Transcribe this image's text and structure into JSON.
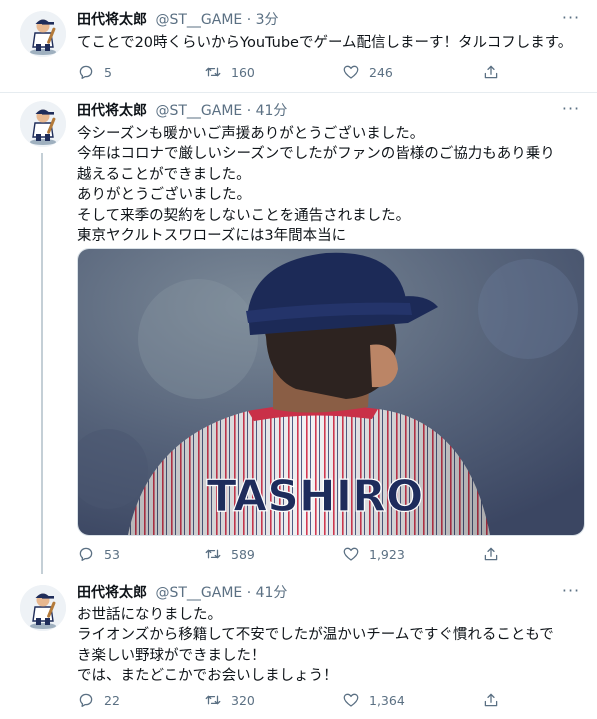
{
  "colors": {
    "text": "#0f1419",
    "muted": "#5b7083",
    "divider": "#e6ecf0",
    "thread": "#c4cfd6"
  },
  "tweets": [
    {
      "name": "田代将太郎",
      "handle": "@ST__GAME",
      "dot": "·",
      "time": "3分",
      "lines": [
        "てことで20時くらいからYouTubeでゲーム配信しまーす！タルコフします。"
      ],
      "replies": "5",
      "retweets": "160",
      "likes": "246"
    },
    {
      "name": "田代将太郎",
      "handle": "@ST__GAME",
      "dot": "·",
      "time": "41分",
      "lines": [
        "今シーズンも暖かいご声援ありがとうございました。",
        "今年はコロナで厳しいシーズンでしたがファンの皆様のご協力もあり乗り",
        "越えることができました。",
        "ありがとうございました。",
        "そして来季の契約をしないことを通告されました。",
        "東京ヤクルトスワローズには3年間本当に"
      ],
      "jersey_text": "TASHIRO",
      "replies": "53",
      "retweets": "589",
      "likes": "1,923"
    },
    {
      "name": "田代将太郎",
      "handle": "@ST__GAME",
      "dot": "·",
      "time": "41分",
      "lines": [
        "お世話になりました。",
        "ライオンズから移籍して不安でしたが温かいチームですぐ慣れることもで",
        "き楽しい野球ができました！",
        "では、またどこかでお会いしましょう！"
      ],
      "replies": "22",
      "retweets": "320",
      "likes": "1,364"
    }
  ]
}
